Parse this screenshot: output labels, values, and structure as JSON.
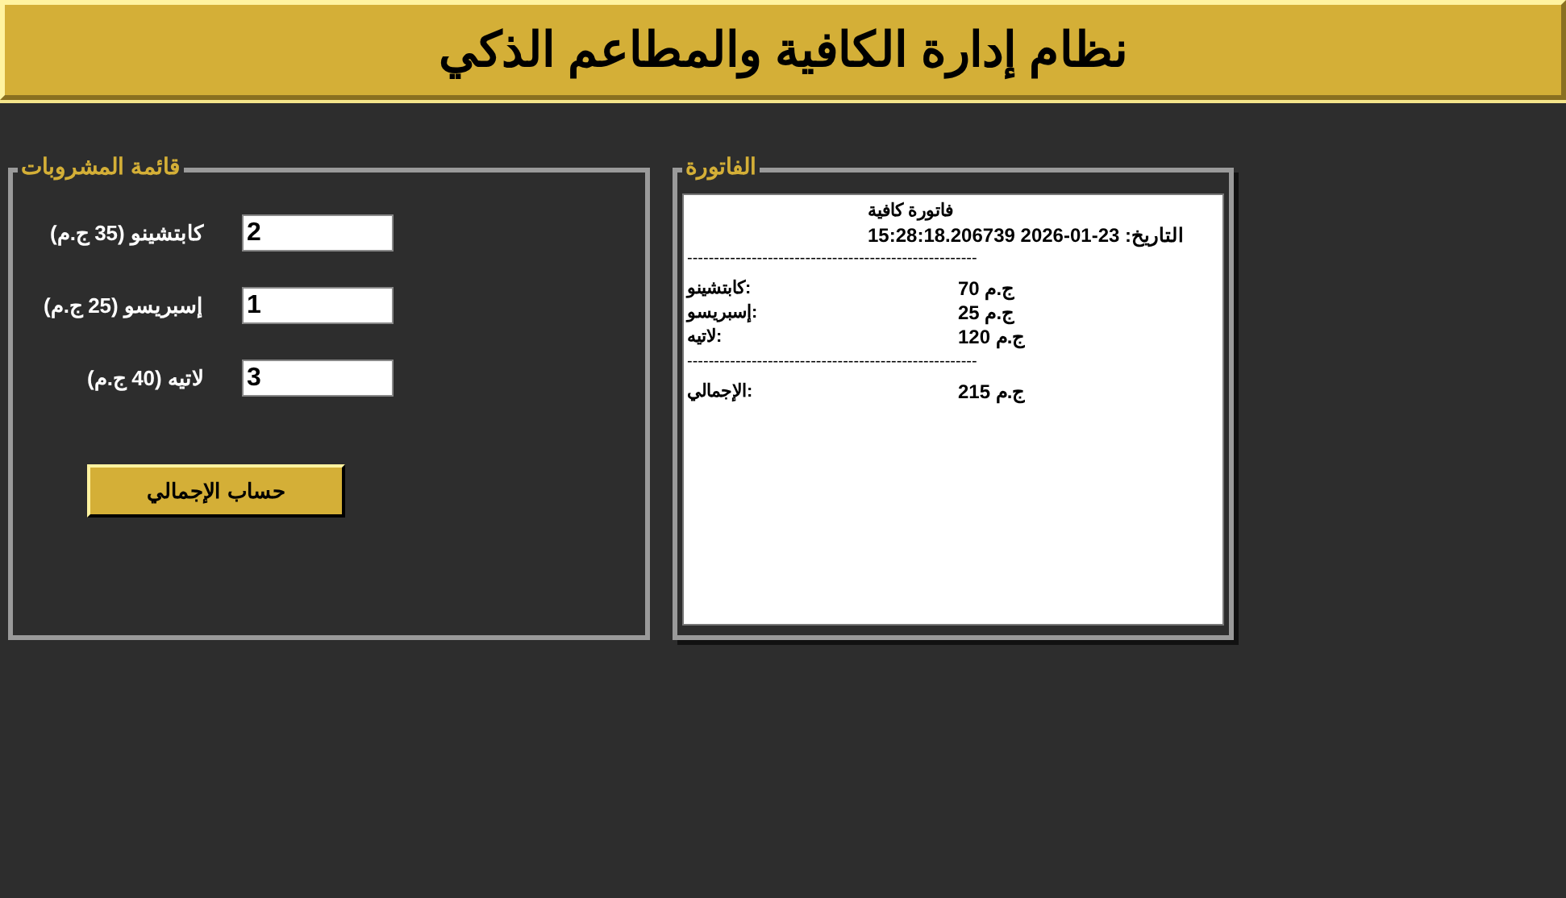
{
  "header": {
    "title": "نظام إدارة الكافية والمطاعم الذكي"
  },
  "drinks_panel": {
    "title": "قائمة المشروبات",
    "items": [
      {
        "label": "كابتشينو (35 ج.م)",
        "value": "2"
      },
      {
        "label": "إسبريسو (25 ج.م)",
        "value": "1"
      },
      {
        "label": "لاتيه (40 ج.م)",
        "value": "3"
      }
    ],
    "button": "حساب الإجمالي"
  },
  "invoice_panel": {
    "title": "الفاتورة",
    "heading": "فاتورة كافية",
    "date_line": "التاريخ: 23-01-2026 15:28:18.206739",
    "separators": [
      "------------------------------------------------------",
      "------------------------------------------------------"
    ],
    "lines": [
      {
        "label": "كابتشينو:",
        "amount": "70 ج.م"
      },
      {
        "label": "إسبريسو:",
        "amount": "25 ج.م"
      },
      {
        "label": "لاتيه:",
        "amount": "120 ج.م"
      }
    ],
    "total": {
      "label": "الإجمالي:",
      "amount": "215 ج.م"
    }
  }
}
